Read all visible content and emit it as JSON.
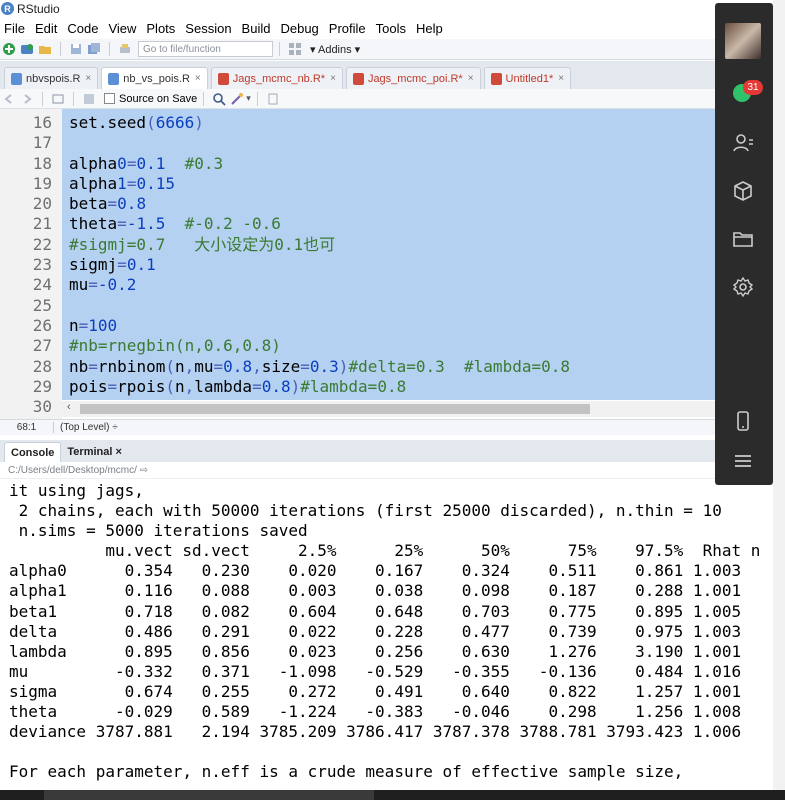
{
  "window": {
    "title": "RStudio"
  },
  "menu": [
    "File",
    "Edit",
    "Code",
    "View",
    "Plots",
    "Session",
    "Build",
    "Debug",
    "Profile",
    "Tools",
    "Help"
  ],
  "toolbar": {
    "goto_placeholder": "Go to file/function",
    "addins_label": "Addins"
  },
  "tabs": [
    {
      "label": "nbvspois.R",
      "modified": false,
      "type": "R"
    },
    {
      "label": "nb_vs_pois.R",
      "modified": false,
      "type": "R"
    },
    {
      "label": "Jags_mcmc_nb.R*",
      "modified": true,
      "type": "R"
    },
    {
      "label": "Jags_mcmc_poi.R*",
      "modified": true,
      "type": "R"
    },
    {
      "label": "Untitled1*",
      "modified": true,
      "type": "R"
    }
  ],
  "editor_toolbar": {
    "source_on_save_label": "Source on Save"
  },
  "editor": {
    "lines": [
      {
        "n": "16",
        "code": "set.seed(6666)"
      },
      {
        "n": "17",
        "code": ""
      },
      {
        "n": "18",
        "code": "alpha0=0.1  #0.3"
      },
      {
        "n": "19",
        "code": "alpha1=0.15"
      },
      {
        "n": "20",
        "code": "beta=0.8"
      },
      {
        "n": "21",
        "code": "theta=-1.5  #-0.2 -0.6"
      },
      {
        "n": "22",
        "code": "#sigmj=0.7   大小设定为0.1也可"
      },
      {
        "n": "23",
        "code": "sigmj=0.1"
      },
      {
        "n": "24",
        "code": "mu=-0.2"
      },
      {
        "n": "25",
        "code": ""
      },
      {
        "n": "26",
        "code": "n=100"
      },
      {
        "n": "27",
        "code": "#nb=rnegbin(n,0.6,0.8)"
      },
      {
        "n": "28",
        "code": "nb=rnbinom(n,mu=0.8,size=0.3)#delta=0.3  #lambda=0.8"
      },
      {
        "n": "29",
        "code": "pois=rpois(n,lambda=0.8)#lambda=0.8"
      },
      {
        "n": "30",
        "code": ""
      }
    ]
  },
  "editor_status": {
    "cursor": "68:1",
    "level": "(Top Level) ÷"
  },
  "console_tabs": [
    {
      "label": "Console",
      "active": true
    },
    {
      "label": "Terminal ×",
      "active": false
    }
  ],
  "console_path": "C:/Users/dell/Desktop/mcmc/ ⇨",
  "console_lines": [
    "it using jags,",
    " 2 chains, each with 50000 iterations (first 25000 discarded), n.thin = 10",
    " n.sims = 5000 iterations saved",
    "          mu.vect sd.vect     2.5%      25%      50%      75%    97.5%  Rhat n",
    "alpha0      0.354   0.230    0.020    0.167    0.324    0.511    0.861 1.003",
    "alpha1      0.116   0.088    0.003    0.038    0.098    0.187    0.288 1.001",
    "beta1       0.718   0.082    0.604    0.648    0.703    0.775    0.895 1.005",
    "delta       0.486   0.291    0.022    0.228    0.477    0.739    0.975 1.003",
    "lambda      0.895   0.856    0.023    0.256    0.630    1.276    3.190 1.001",
    "mu         -0.332   0.371   -1.098   -0.529   -0.355   -0.136    0.484 1.016",
    "sigma       0.674   0.255    0.272    0.491    0.640    0.822    1.257 1.001",
    "theta      -0.029   0.589   -1.224   -0.383   -0.046    0.298    1.256 1.008",
    "deviance 3787.881   2.194 3785.209 3786.417 3787.378 3788.781 3793.423 1.006",
    "",
    "For each parameter, n.eff is a crude measure of effective sample size,"
  ],
  "side_panel": {
    "badge_count": "31"
  }
}
